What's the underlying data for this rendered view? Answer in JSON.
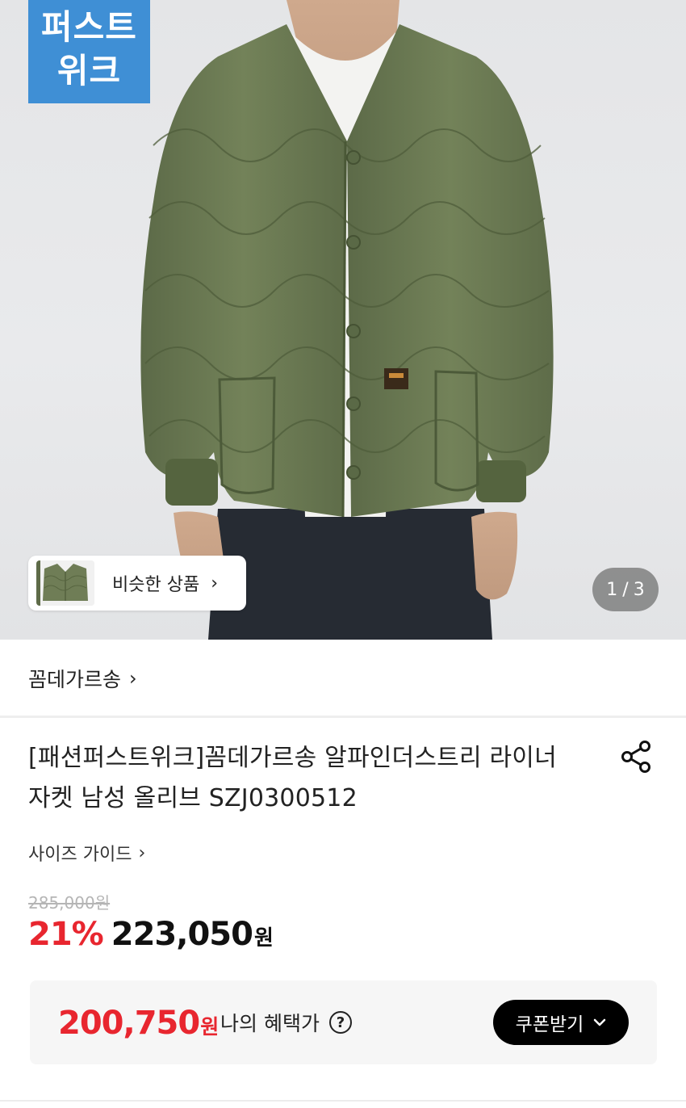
{
  "hero": {
    "badge_line1": "퍼스트",
    "badge_line2": "위크",
    "similar_label": "비슷한 상품",
    "similar_chevron": "›",
    "counter_current": "1",
    "counter_sep": "/",
    "counter_total": "3",
    "product_colors": {
      "jacket": "#6b7a57",
      "jacket_shadow": "#56643f",
      "tee": "#f4f4f2",
      "pants": "#2a2f36",
      "skin": "#caa489",
      "background": "#e6e7e9"
    }
  },
  "brand": {
    "name": "꼼데가르송",
    "chevron": "›"
  },
  "product": {
    "title": "[패션퍼스트위크]꼼데가르송 알파인더스트리 라이너 자켓 남성 올리브 SZJ0300512",
    "share_icon": "share-icon",
    "size_guide": "사이즈 가이드",
    "size_chevron": "›",
    "original_price": "285,000원",
    "discount_rate": "21%",
    "sale_price": "223,050",
    "sale_unit": "원"
  },
  "benefit": {
    "price": "200,750",
    "unit": "원",
    "label": "나의 혜택가",
    "help_symbol": "?",
    "coupon_button": "쿠폰받기",
    "coupon_chevron": "⌄"
  },
  "colors": {
    "accent_red": "#e8262f",
    "badge_blue": "#3f8fd5",
    "button_black": "#000000"
  }
}
